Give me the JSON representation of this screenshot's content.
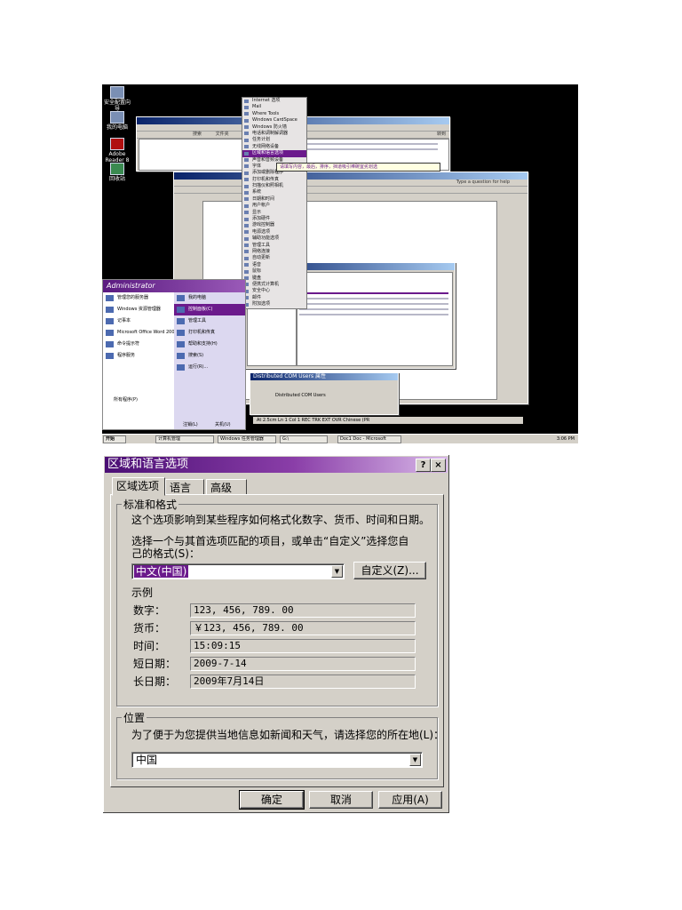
{
  "desktop": {
    "start_menu_user": "Administrator",
    "start_label": "开始",
    "explorer_search_label": "搜索",
    "explorer_folders_label": "文件夹",
    "explorer_go_label": "转到",
    "word_help_placeholder": "Type a question for help",
    "status_bar": "At 2.5cm   Ln 1   Col 1     REC  TRK  EXT  OVR   Chinese (PR",
    "clock": "3:06 PM",
    "dcom_title": "Distributed COM Users 属性",
    "dcom_name": "Distributed COM Users",
    "balloon": "请填写内容，最后，排序，挡道吸引棒碗宜劣划选",
    "control_panel_items": [
      "Internet 选项",
      "Mail",
      "Where Tools",
      "Windows CardSpace",
      "Windows 防火墙",
      "电话和调制解调器",
      "任务计划",
      "无线网络设备",
      "区域和语言选项",
      "声音和音频设备",
      "字体",
      "添加或删除程序",
      "打印机和传真",
      "扫描仪和照相机",
      "系统",
      "日期和时间",
      "用户帐户",
      "显示",
      "添加硬件",
      "游戏控制器",
      "电源选项",
      "辅助功能选项",
      "管理工具",
      "网络连接",
      "自动更新",
      "语音",
      "鼠标",
      "键盘",
      "便携式计算机",
      "安全中心",
      "邮件",
      "附加选项"
    ],
    "start_left_items": [
      "管理您的服务器",
      "Windows 资源管理器",
      "记事本",
      "Microsoft Office Word 2003",
      "命令提示符",
      "程序服务"
    ],
    "start_right_items": [
      "我的电脑",
      "控制面板(C)",
      "管理工具",
      "打印机和传真",
      "帮助和支持(H)",
      "搜索(S)",
      "运行(R)..."
    ],
    "start_all_programs": "所有程序(P)",
    "start_logoff": "注销(L)",
    "start_shutdown": "关机(U)",
    "desktop_icons": [
      "安全配置向导",
      "我的电脑",
      "Adobe Reader 8",
      "回收站"
    ],
    "taskbar_items": [
      "计算机管理",
      "Windows 任务管理器",
      "G:\\",
      "Doc1 Doc - Microsoft"
    ]
  },
  "dialog": {
    "title": "区域和语言选项",
    "help_btn": "?",
    "close_btn": "×",
    "tabs": [
      "区域选项",
      "语言",
      "高级"
    ],
    "group_standards": "标准和格式",
    "description": "这个选项影响到某些程序如何格式化数字、货币、时间和日期。",
    "select_line1": "选择一个与其首选项匹配的项目，或单击“自定义”选择您自",
    "select_line2": "己的格式(S)：",
    "locale": "中文(中国)",
    "customize_button": "自定义(Z)...",
    "samples_label": "示例",
    "samples": [
      {
        "label": "数字：",
        "value": "123, 456, 789. 00"
      },
      {
        "label": "货币：",
        "value": "￥123, 456, 789. 00"
      },
      {
        "label": "时间：",
        "value": "15:09:15"
      },
      {
        "label": "短日期：",
        "value": "2009-7-14"
      },
      {
        "label": "长日期：",
        "value": "2009年7月14日"
      }
    ],
    "group_location": "位置",
    "location_text": "为了便于为您提供当地信息如新闻和天气，请选择您的所在地(L)：",
    "location": "中国",
    "ok_button": "确定",
    "cancel_button": "取消",
    "apply_button": "应用(A)"
  }
}
